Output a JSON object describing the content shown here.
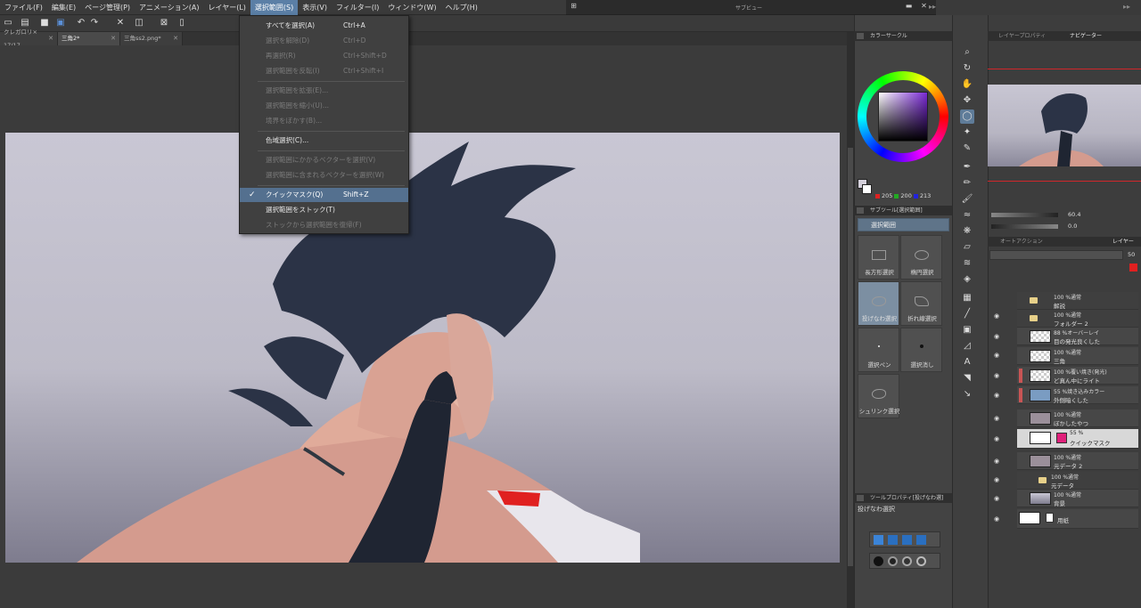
{
  "menubar": {
    "items": [
      "ファイル(F)",
      "編集(E)",
      "ページ管理(P)",
      "アニメーション(A)",
      "レイヤー(L)",
      "選択範囲(S)",
      "表示(V)",
      "フィルター(I)",
      "ウィンドウ(W)",
      "ヘルプ(H)"
    ],
    "active_index": 5
  },
  "preview_window": {
    "title": "サブビュー"
  },
  "tabs": [
    {
      "label": "クレガロリ× 17/17"
    },
    {
      "label": "三角2*"
    },
    {
      "label": "三角ss2.png*"
    }
  ],
  "dropdown": {
    "items": [
      {
        "label": "すべてを選択(A)",
        "shortcut": "Ctrl+A",
        "enabled": true
      },
      {
        "label": "選択を解除(D)",
        "shortcut": "Ctrl+D",
        "enabled": false
      },
      {
        "label": "再選択(R)",
        "shortcut": "Ctrl+Shift+D",
        "enabled": false
      },
      {
        "label": "選択範囲を反転(I)",
        "shortcut": "Ctrl+Shift+I",
        "enabled": false
      },
      {
        "label": "選択範囲を拡張(E)...",
        "shortcut": "",
        "enabled": false
      },
      {
        "label": "選択範囲を縮小(U)...",
        "shortcut": "",
        "enabled": false
      },
      {
        "label": "境界をぼかす(B)...",
        "shortcut": "",
        "enabled": false
      },
      {
        "label": "色域選択(C)...",
        "shortcut": "",
        "enabled": true
      },
      {
        "label": "選択範囲にかかるベクターを選択(V)",
        "shortcut": "",
        "enabled": false
      },
      {
        "label": "選択範囲に含まれるベクターを選択(W)",
        "shortcut": "",
        "enabled": false
      },
      {
        "label": "クイックマスク(Q)",
        "shortcut": "Shift+Z",
        "enabled": true,
        "checked": true
      },
      {
        "label": "選択範囲をストック(T)",
        "shortcut": "",
        "enabled": true
      },
      {
        "label": "ストックから選択範囲を復帰(F)",
        "shortcut": "",
        "enabled": false
      }
    ]
  },
  "panels": {
    "color_circle": {
      "title": "カラーサークル",
      "r": "205",
      "g": "200",
      "b": "213"
    },
    "subtool": {
      "title": "サブツール[選択範囲]",
      "group": "選択範囲"
    },
    "tool_property": {
      "title": "ツールプロパティ[投げなわ選]",
      "tool_name": "投げなわ選択"
    },
    "navigator": {
      "tabs": [
        "レイヤープロパティ",
        "ナビゲーター"
      ],
      "zoom": "60.4",
      "angle": "0.0"
    },
    "layers": {
      "tabs": [
        "オートアクション",
        "レイヤー"
      ],
      "opacity": "50"
    }
  },
  "subtools": [
    {
      "label": "長方形選択",
      "shape": "rect"
    },
    {
      "label": "楕円選択",
      "shape": "ellipse"
    },
    {
      "label": "投げなわ選択",
      "shape": "lasso",
      "selected": true
    },
    {
      "label": "折れ線選択",
      "shape": "polyline"
    },
    {
      "label": "選択ペン",
      "shape": "dot"
    },
    {
      "label": "選択消し",
      "shape": "dot"
    },
    {
      "label": "シュリンク選択",
      "shape": "lasso"
    }
  ],
  "layers": [
    {
      "mode": "100 %通常",
      "name": "解説",
      "type": "folder"
    },
    {
      "mode": "100 %通常",
      "name": "フォルダー 2",
      "type": "folder-open"
    },
    {
      "mode": "88 %オーバーレイ",
      "name": "目の発光良くした",
      "type": "layer"
    },
    {
      "mode": "100 %通常",
      "name": "三角",
      "type": "layer"
    },
    {
      "mode": "100 %覆い焼き(発光)",
      "name": "ど真ん中にライト",
      "type": "layer",
      "marked": true
    },
    {
      "mode": "55 %焼き込みカラー",
      "name": "外側暗くした",
      "type": "layer",
      "marked": true
    },
    {
      "mode": "100 %通常",
      "name": "ぼかしたやつ",
      "type": "layer"
    },
    {
      "mode": "55 %",
      "name": "クイックマスク",
      "type": "mask",
      "selected": true
    },
    {
      "mode": "100 %通常",
      "name": "元データ 2",
      "type": "layer"
    },
    {
      "mode": "100 %通常",
      "name": "元データ",
      "type": "folder"
    },
    {
      "mode": "100 %通常",
      "name": "背景",
      "type": "layer"
    },
    {
      "mode": "",
      "name": "用紙",
      "type": "paper"
    }
  ],
  "colors": {
    "accent": "#5b7fa6",
    "selected_row": "#54708f",
    "quickmask": "#e0207a"
  }
}
